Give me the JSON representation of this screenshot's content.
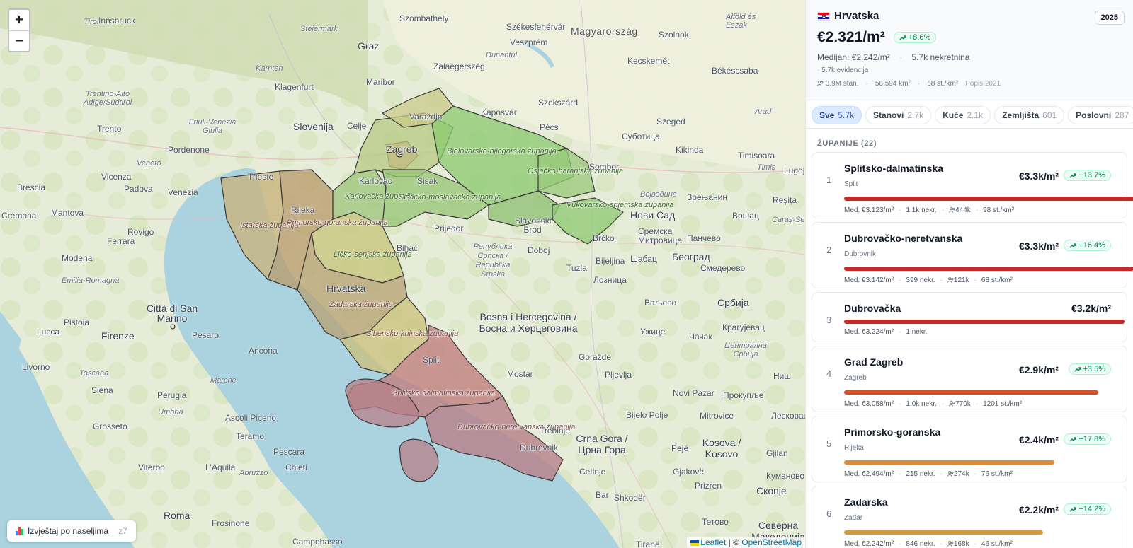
{
  "map": {
    "zoom_in": "+",
    "zoom_out": "−",
    "report_button": {
      "label": "Izvještaj po naseljima",
      "zoom": "z7"
    },
    "attribution": {
      "leaflet": "Leaflet",
      "sep": "| ©",
      "osm": "OpenStreetMap"
    },
    "labels": {
      "magyarorszag": "Magyarország",
      "szombathely": "Szombathely",
      "szekesfehervar": "Székesfehérvár",
      "szolnok": "Szolnok",
      "alfold": "Alföld és Észak",
      "graz": "Graz",
      "steiermark": "Steiermark",
      "veszprem": "Veszprém",
      "dunantul": "Dunántúl",
      "kecskemet": "Kecskemét",
      "zalaegerszeg": "Zalaegerszeg",
      "innsbruck": "Innsbruck",
      "tirol": "Tirol",
      "karnten": "Kärnten",
      "maribor": "Maribor",
      "bekescsaba": "Békéscsaba",
      "klagenfurt": "Klagenfurt",
      "szekszard": "Szekszárd",
      "trentino": "Trentino-Alto Adige/Südtirol",
      "kaposvar": "Kaposvár",
      "arad": "Arad",
      "varazdin": "Varaždin",
      "friuli": "Friuli-Venezia Giulia",
      "slovenija": "Slovenija",
      "celje": "Celje",
      "pecs": "Pécs",
      "subotica": "Суботица",
      "szeged": "Szeged",
      "trento": "Trento",
      "pordenone": "Pordenone",
      "kikinda": "Kikinda",
      "timisoara": "Timișoara",
      "timis": "Timiș",
      "zagreb": "Zagreb",
      "sombor": "Sombor",
      "lugoj": "Lugoj",
      "bjelovarska": "Bjelovarsko-bilogorska županija",
      "veneto": "Veneto",
      "trieste": "Trieste",
      "vicenza": "Vicenza",
      "karlovac": "Karlovac",
      "sisak": "Sisak",
      "osjecko": "Osječko-baranjska županija",
      "brescia": "Brescia",
      "padova": "Padova",
      "venezia": "Venezia",
      "vojvodina": "Војводина",
      "zrenjanin": "Зрењанин",
      "resita": "Reșița",
      "rijeka": "Rijeka",
      "karlovacka": "Karlovačka županija",
      "sisacko": "Sisačko-moslavačka županija",
      "novisad": "Нови Сад",
      "vrsac": "Вршац",
      "carasseverin": "Caraș-Severin",
      "cremona": "Cremona",
      "mantova": "Mantova",
      "rovigo": "Rovigo",
      "istarska": "Istarska županija",
      "primorsko": "Primorsko-goranska županija",
      "slbrod": "Slavonski Brod",
      "vukovarsko": "Vukovarsko-srijemska županija",
      "sremska": "Сремска Митровица",
      "pancevo": "Панчево",
      "ferrara": "Ferrara",
      "prijedor": "Prijedor",
      "brcko": "Brčko",
      "beograd": "Београд",
      "modena": "Modena",
      "bihac": "Bihać",
      "lickosenjska": "Ličko-senjska županija",
      "republika": "Република Српска / Republika Srpska",
      "doboj": "Doboj",
      "bijeljina": "Bijeljina",
      "sabac": "Шабац",
      "smederevo": "Смедерево",
      "emilia": "Emilia-Romagna",
      "tuzla": "Tuzla",
      "loznica": "Лозница",
      "hrvatska": "Hrvatska",
      "zadarska": "Zadarska županija",
      "valjevo": "Ваљево",
      "srbija": "Србија",
      "sanmarino": "Città di San Marino",
      "pistoia": "Pistoia",
      "bosna": "Bosna i Hercegovina / Босна и Херцеговина",
      "kragujevac": "Крагујевац",
      "lucca": "Lucca",
      "firenze": "Firenze",
      "pesaro": "Pesaro",
      "sibenik": "Šibensko-kninska županija",
      "uzice": "Ужице",
      "cacak": "Чачак",
      "ancona": "Ancona",
      "livorno": "Livorno",
      "split": "Split",
      "gorazde": "Goražde",
      "centralna": "Централна Србија",
      "nis": "Ниш",
      "toscana": "Toscana",
      "marche": "Marche",
      "splitsko": "Splitsko-dalmatinska županija",
      "mostar": "Mostar",
      "pljevlja": "Pljevlja",
      "novipazar": "Novi Pazar",
      "prokuplje": "Прокупље",
      "siena": "Siena",
      "perugia": "Perugia",
      "umbria": "Umbria",
      "bijelopolje": "Bijelo Polje",
      "mitrovice": "Mitrovice",
      "leskovac": "Лесковац",
      "grosseto": "Grosseto",
      "ascoli": "Ascoli Piceno",
      "dubrovacko": "Dubrovačko-neretvanska županija",
      "trebinje": "Trebinje",
      "crnagora": "Crna Gora / Црна Гора",
      "kosovo": "Kosova / Kosovo",
      "teramo": "Teramo",
      "pescara": "Pescara",
      "dubrovnik": "Dubrovnik",
      "peje": "Pejë",
      "gjilan": "Gjilan",
      "viterbo": "Viterbo",
      "laquila": "L'Aquila",
      "chieti": "Chieti",
      "abruzzo": "Abruzzo",
      "cetinje": "Cetinje",
      "gjakove": "Gjakovë",
      "prizren": "Prizren",
      "kumanovo": "Куманово",
      "skopje": "Скопје",
      "bar": "Bar",
      "shkoder": "Shkodër",
      "roma": "Roma",
      "frosinone": "Frosinone",
      "tetovo": "Тетово",
      "severna": "Северна Македонија",
      "campobasso": "Campobasso",
      "tirane": "Tiranë"
    }
  },
  "panel": {
    "country": "Hrvatska",
    "year": "2025",
    "price": "€2.321/m²",
    "change": "+8.6%",
    "median_label": "Medijan: €2.242/m²",
    "listings": "5.7k nekretnina",
    "records": "5.7k evidencija",
    "population": "3.9M stan.",
    "area": "56.594 km²",
    "density": "68 st./km²",
    "census": "Popis 2021",
    "tabs": [
      {
        "label": "Sve",
        "count": "5.7k"
      },
      {
        "label": "Stanovi",
        "count": "2.7k"
      },
      {
        "label": "Kuće",
        "count": "2.1k"
      },
      {
        "label": "Zemljišta",
        "count": "601"
      },
      {
        "label": "Poslovni",
        "count": "287"
      },
      {
        "label": "O",
        "count": ""
      }
    ],
    "section_title": "ŽUPANIJE (22)",
    "counties": [
      {
        "rank": "1",
        "name": "Splitsko-dalmatinska",
        "city": "Split",
        "price": "€3.3k/m²",
        "change": "+13.7%",
        "median": "Med. €3.123/m²",
        "listings": "1.1k nekr.",
        "population": "444k",
        "density": "98 st./km²",
        "share": 1.0,
        "color": "#c62828"
      },
      {
        "rank": "2",
        "name": "Dubrovačko-neretvanska",
        "city": "Dubrovnik",
        "price": "€3.3k/m²",
        "change": "+16.4%",
        "median": "Med. €3.142/m²",
        "listings": "399 nekr.",
        "population": "121k",
        "density": "68 st./km²",
        "share": 0.99,
        "color": "#c62828"
      },
      {
        "rank": "3",
        "name": "Dubrovačka",
        "city": "",
        "price": "€3.2k/m²",
        "change": "",
        "median": "Med. €3.224/m²",
        "listings": "1 nekr.",
        "population": "",
        "density": "",
        "share": 0.96,
        "color": "#c62828"
      },
      {
        "rank": "4",
        "name": "Grad Zagreb",
        "city": "Zagreb",
        "price": "€2.9k/m²",
        "change": "+3.5%",
        "median": "Med. €3.058/m²",
        "listings": "1.0k nekr.",
        "population": "770k",
        "density": "1201 st./km²",
        "share": 0.87,
        "color": "#d1502a"
      },
      {
        "rank": "5",
        "name": "Primorsko-goranska",
        "city": "Rijeka",
        "price": "€2.4k/m²",
        "change": "+17.8%",
        "median": "Med. €2.494/m²",
        "listings": "215 nekr.",
        "population": "274k",
        "density": "76 st./km²",
        "share": 0.72,
        "color": "#d98a3a"
      },
      {
        "rank": "6",
        "name": "Zadarska",
        "city": "Zadar",
        "price": "€2.2k/m²",
        "change": "+14.2%",
        "median": "Med. €2.242/m²",
        "listings": "846 nekr.",
        "population": "168k",
        "density": "46 st./km²",
        "share": 0.68,
        "color": "#d49a3e"
      }
    ]
  }
}
